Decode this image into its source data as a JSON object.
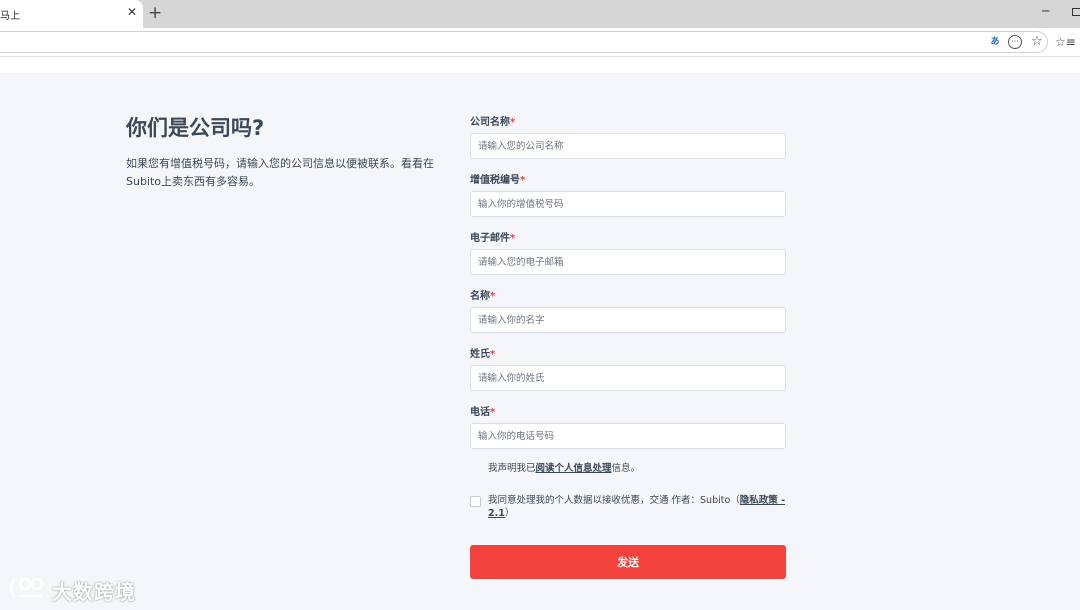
{
  "browser": {
    "tab_title": "马上",
    "tab_close": "✕",
    "new_tab": "+",
    "minimize": "─",
    "translate_icon": "あ",
    "reader_icon": "···",
    "favorite_icon": "☆",
    "favorites_icon": "☆≡"
  },
  "intro": {
    "title": "你们是公司吗?",
    "description": "如果您有增值税号码，请输入您的公司信息以便被联系。看看在Subito上卖东西有多容易。"
  },
  "form": {
    "fields": [
      {
        "label": "公司名称",
        "required": "*",
        "placeholder": "请输入您的公司名称"
      },
      {
        "label": "增值税编号",
        "required": "*",
        "placeholder": "输入你的增值税号码"
      },
      {
        "label": "电子邮件",
        "required": "*",
        "placeholder": "请输入您的电子邮箱"
      },
      {
        "label": "名称",
        "required": "*",
        "placeholder": "请输入你的名字"
      },
      {
        "label": "姓氏",
        "required": "*",
        "placeholder": "请输入你的姓氏"
      },
      {
        "label": "电话",
        "required": "*",
        "placeholder": "输入你的电话号码"
      }
    ],
    "notice_prefix": "我声明我已",
    "notice_link": "阅读个人信息处理",
    "notice_suffix": "信息。",
    "consent_text": "我同意处理我的个人数据以接收优惠，交通 作者：Subito（",
    "consent_link": "隐私政策 - 2.1",
    "consent_suffix": "）",
    "submit_label": "发送"
  },
  "watermark": {
    "text": "大数跨境"
  },
  "colors": {
    "accent": "#f4433c",
    "text": "#3c4858",
    "background": "#f5f6f9"
  }
}
